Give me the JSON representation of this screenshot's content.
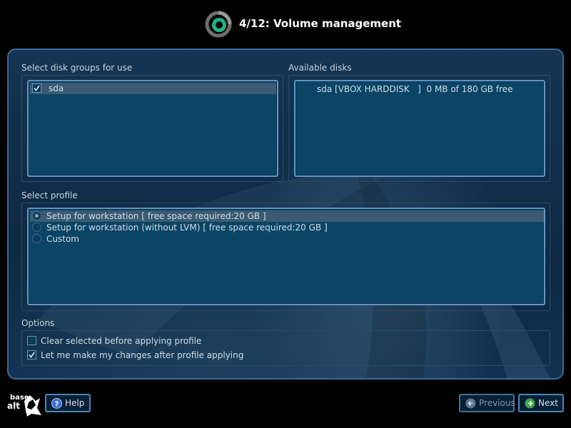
{
  "header": {
    "title": "4/12: Volume management",
    "logo_icon": "installer-ring-icon"
  },
  "disk_groups": {
    "label": "Select disk groups for use",
    "items": [
      {
        "label": "sda",
        "checked": true,
        "selected": true
      }
    ]
  },
  "available_disks": {
    "label": "Available disks",
    "items": [
      {
        "label": "sda [VBOX HARDDISK   ]  0 MB of 180 GB free"
      }
    ]
  },
  "profile": {
    "label": "Select profile",
    "items": [
      {
        "label": "Setup for workstation [ free space required:20 GB ]",
        "selected": true
      },
      {
        "label": "Setup for workstation (without LVM) [ free space required:20 GB ]",
        "selected": false
      },
      {
        "label": "Custom",
        "selected": false
      }
    ]
  },
  "options": {
    "label": "Options",
    "items": [
      {
        "label": "Clear selected before applying profile",
        "checked": false
      },
      {
        "label": "Let me make my changes after profile applying",
        "checked": true
      }
    ]
  },
  "footer": {
    "logo_text_top": "base",
    "logo_text_bottom": "alt",
    "help_label": "Help",
    "previous_label": "Previous",
    "next_label": "Next"
  },
  "colors": {
    "frame_border": "#3a6a9a",
    "list_bg": "#0b4566",
    "list_border": "#5f95c4",
    "selected_row": "#3c5a74",
    "accent_green": "#3ab88a"
  }
}
